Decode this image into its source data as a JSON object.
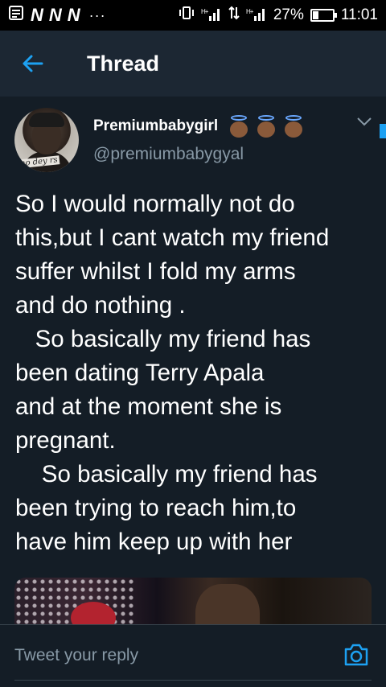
{
  "status_bar": {
    "notification_icons": [
      "N",
      "N",
      "N"
    ],
    "overflow": "···",
    "signal_1": "H+",
    "signal_2": "H+",
    "battery_percent": "27%",
    "time": "11:01"
  },
  "header": {
    "title": "Thread"
  },
  "tweet": {
    "display_name": "Premiumbabygirl",
    "username": "@premiumbabygyal",
    "avatar_caption": "mo dey rs",
    "text": "So I would normally not do\nthis,but I cant watch my friend\nsuffer whilst I fold my arms\nand do nothing .\n   So basically my friend has\nbeen dating Terry Apala\nand at the moment she is\npregnant.\n    So basically my friend has\nbeen trying to reach him,to\nhave him keep up with her"
  },
  "reply": {
    "placeholder": "Tweet your reply"
  },
  "colors": {
    "background": "#141d26",
    "header_bg": "#1c2733",
    "accent": "#1da1f2",
    "muted_text": "#8899a6",
    "divider": "#38444d"
  }
}
